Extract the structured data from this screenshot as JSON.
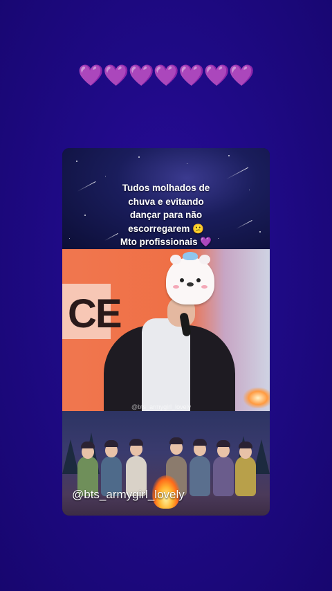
{
  "header": {
    "hearts": "💜💜💜💜💜💜💜"
  },
  "post": {
    "caption_lines": [
      "Tudos molhados de",
      "chuva e evitando",
      "dançar para não",
      "escorregarem 😕",
      "Mto profissionais 💜"
    ],
    "video_sign_text": "CE",
    "video_watermark": "@bts_armygirl_lovely",
    "handle": "@bts_armygirl_lovely"
  },
  "colors": {
    "background": "#1f0a86",
    "heart": "#b24bf3",
    "video_bg": "#ef6f45"
  }
}
